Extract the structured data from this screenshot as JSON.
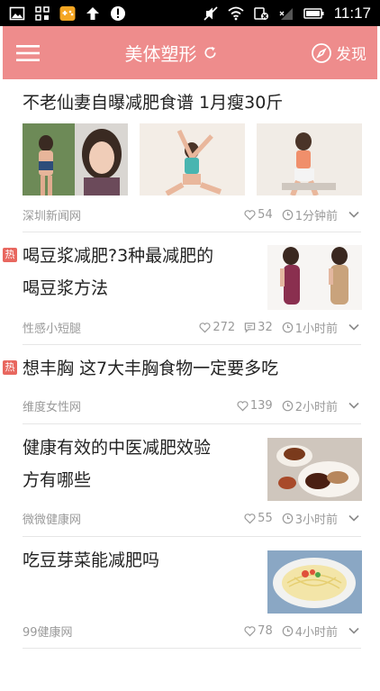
{
  "status_bar": {
    "time": "11:17",
    "left_icons": [
      "image-icon",
      "grid-icon",
      "game-icon",
      "upload-arrow-icon",
      "alert-icon"
    ],
    "right_icons": [
      "mute-icon",
      "wifi-icon",
      "sync-icon",
      "signal-icon",
      "battery-icon"
    ]
  },
  "app_bar": {
    "title": "美体塑形",
    "discover_label": "发现"
  },
  "colors": {
    "accent": "#ee8c8c",
    "hot_badge": "#e8675f"
  },
  "feed": {
    "items": [
      {
        "title": "不老仙妻自曝减肥食谱 1月瘦30斤",
        "hot": false,
        "source": "深圳新闻网",
        "likes": "54",
        "comments": null,
        "time": "1分钟前",
        "images": 3
      },
      {
        "title_lines": [
          "喝豆浆减肥?3种最减肥的",
          "喝豆浆方法"
        ],
        "hot": true,
        "hot_label": "热",
        "source": "性感小短腿",
        "likes": "272",
        "comments": "32",
        "time": "1小时前",
        "images": 1
      },
      {
        "title": "想丰胸 这7大丰胸食物一定要多吃",
        "hot": true,
        "hot_label": "热",
        "source": "维度女性网",
        "likes": "139",
        "comments": null,
        "time": "2小时前",
        "images": 0
      },
      {
        "title_lines": [
          "健康有效的中医减肥效验",
          "方有哪些"
        ],
        "hot": false,
        "source": "微微健康网",
        "likes": "55",
        "comments": null,
        "time": "3小时前",
        "images": 1
      },
      {
        "title": "吃豆芽菜能减肥吗",
        "hot": false,
        "source": "99健康网",
        "likes": "78",
        "comments": null,
        "time": "4小时前",
        "images": 1
      }
    ]
  }
}
